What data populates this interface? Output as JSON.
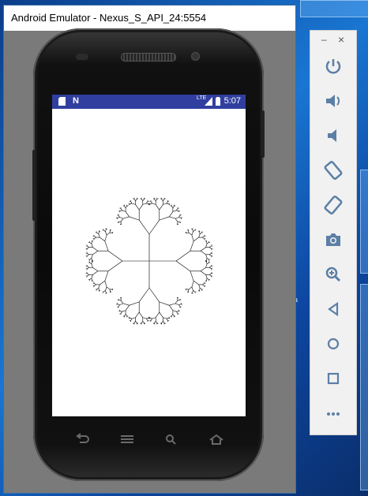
{
  "window": {
    "title": "Android Emulator - Nexus_S_API_24:5554"
  },
  "statusbar": {
    "time": "5:07",
    "network": "LTE"
  },
  "desktop": {
    "partial_text": "a"
  },
  "toolbar": {
    "minimize": "–",
    "close": "×",
    "buttons": [
      "power-icon",
      "volume-up-icon",
      "volume-down-icon",
      "rotate-left-icon",
      "rotate-right-icon",
      "camera-icon",
      "zoom-icon",
      "back-icon",
      "home-icon",
      "overview-icon",
      "more-icon"
    ]
  },
  "colors": {
    "statusbar": "#303f9f",
    "toolbar_icon": "#5b7fa6"
  }
}
